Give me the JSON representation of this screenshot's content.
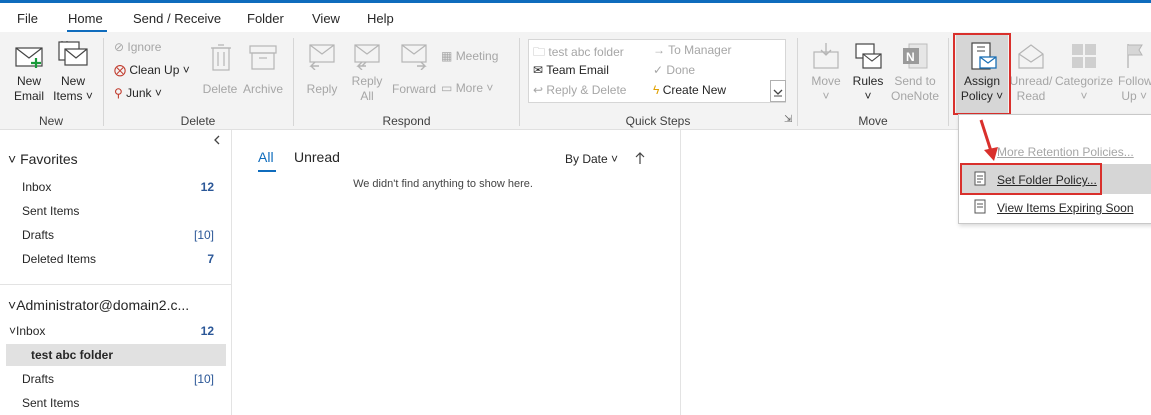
{
  "tabs": {
    "file": "File",
    "home": "Home",
    "send_receive": "Send / Receive",
    "folder": "Folder",
    "view": "View",
    "help": "Help"
  },
  "ribbon": {
    "new_group": {
      "new_email_1": "New",
      "new_email_2": "Email",
      "new_items_1": "New",
      "new_items_2": "Items",
      "label": "New"
    },
    "delete_group": {
      "ignore": "Ignore",
      "clean_up": "Clean Up",
      "junk": "Junk",
      "delete": "Delete",
      "archive": "Archive",
      "label": "Delete"
    },
    "respond_group": {
      "reply": "Reply",
      "reply_all_1": "Reply",
      "reply_all_2": "All",
      "forward": "Forward",
      "meeting": "Meeting",
      "more": "More",
      "label": "Respond"
    },
    "quick_steps": {
      "s1": "test abc folder",
      "s2": "To Manager",
      "s3": "Team Email",
      "s4": "Done",
      "s5": "Reply & Delete",
      "s6": "Create New",
      "label": "Quick Steps"
    },
    "move_group": {
      "move": "Move",
      "rules": "Rules",
      "send_to_onenote_1": "Send to",
      "send_to_onenote_2": "OneNote",
      "label": "Move"
    },
    "assign_policy_1": "Assign",
    "assign_policy_2": "Policy",
    "unread_read_1": "Unread/",
    "unread_read_2": "Read",
    "categorize": "Categorize",
    "follow_up_1": "Follow",
    "follow_up_2": "Up"
  },
  "policy_menu": {
    "more": "More Retention Policies...",
    "set": "Set Folder Policy...",
    "view": "View Items Expiring Soon"
  },
  "folders": {
    "favorites": "Favorites",
    "fav_items": [
      {
        "name": "Inbox",
        "count": "12"
      },
      {
        "name": "Sent Items",
        "count": ""
      },
      {
        "name": "Drafts",
        "count": "[10]"
      },
      {
        "name": "Deleted Items",
        "count": "7"
      }
    ],
    "account": "Administrator@domain2.c...",
    "inbox": "Inbox",
    "inbox_count": "12",
    "subfolder": "test abc folder",
    "drafts": "Drafts",
    "drafts_count": "[10]",
    "sent": "Sent Items"
  },
  "list": {
    "all": "All",
    "unread": "Unread",
    "sort": "By Date",
    "empty": "We didn't find anything to show here."
  },
  "colors": {
    "accent": "#0f6cbd",
    "highlight_red": "#d9302c"
  }
}
